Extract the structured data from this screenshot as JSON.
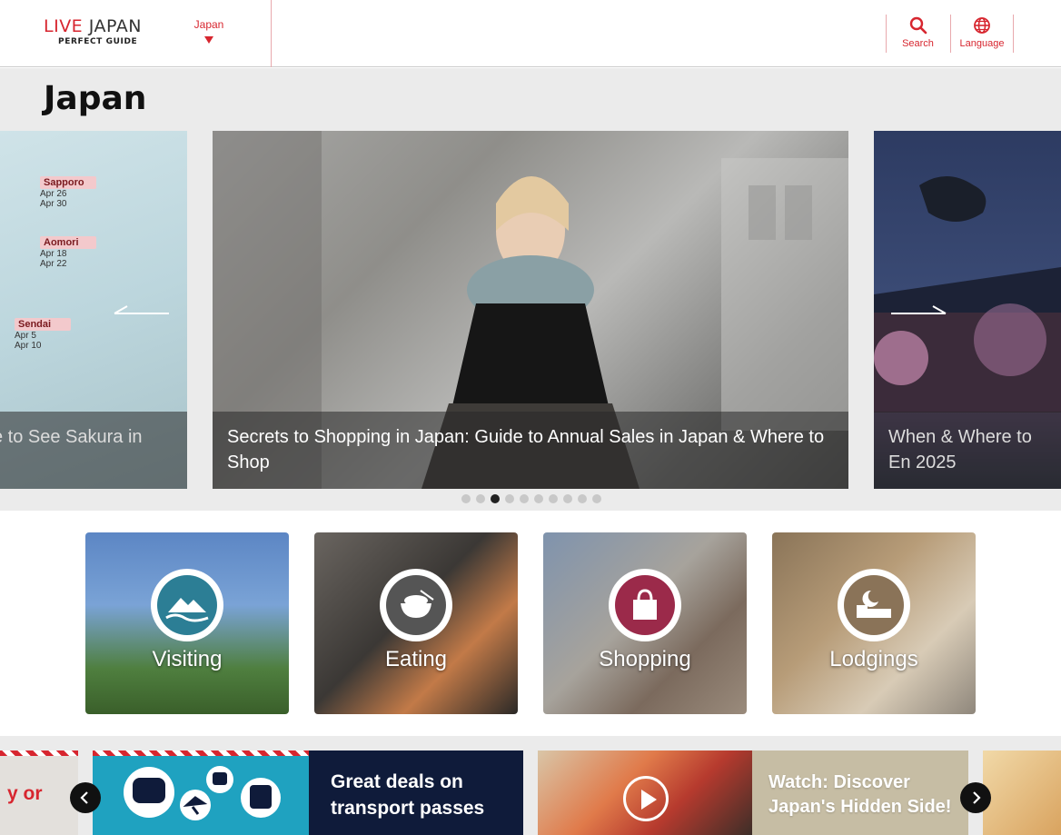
{
  "header": {
    "logo_live": "LIVE",
    "logo_japan": "JAPAN",
    "logo_sub": "PERFECT GUIDE",
    "region": "Japan",
    "search_label": "Search",
    "language_label": "Language"
  },
  "page_title": "Japan",
  "carousel": {
    "left_caption": "e to See Sakura in",
    "map_tags": [
      {
        "city": "Sapporo",
        "d1": "Apr 26",
        "d2": "Apr 30"
      },
      {
        "city": "Aomori",
        "d1": "Apr 18",
        "d2": "Apr 22"
      },
      {
        "city": "Sendai",
        "d1": "Apr 5",
        "d2": "Apr 10"
      }
    ],
    "main_caption": "Secrets to Shopping in Japan: Guide to Annual Sales in Japan & Where to Shop",
    "right_caption": "When & Where to En 2025",
    "dots_count": 10,
    "active_dot": 3
  },
  "categories": [
    {
      "label": "Visiting",
      "icon": "mountain-wave-icon"
    },
    {
      "label": "Eating",
      "icon": "rice-bowl-icon"
    },
    {
      "label": "Shopping",
      "icon": "shopping-bag-icon"
    },
    {
      "label": "Lodgings",
      "icon": "bed-moon-icon"
    }
  ],
  "banners": {
    "left_partial": "y or",
    "transport": "Great deals on transport passes",
    "video": "Watch: Discover Japan's Hidden Side!"
  },
  "colors": {
    "brand_red": "#d7262f",
    "transport_blue": "#1fa2c0",
    "navy": "#0f1b3a"
  }
}
